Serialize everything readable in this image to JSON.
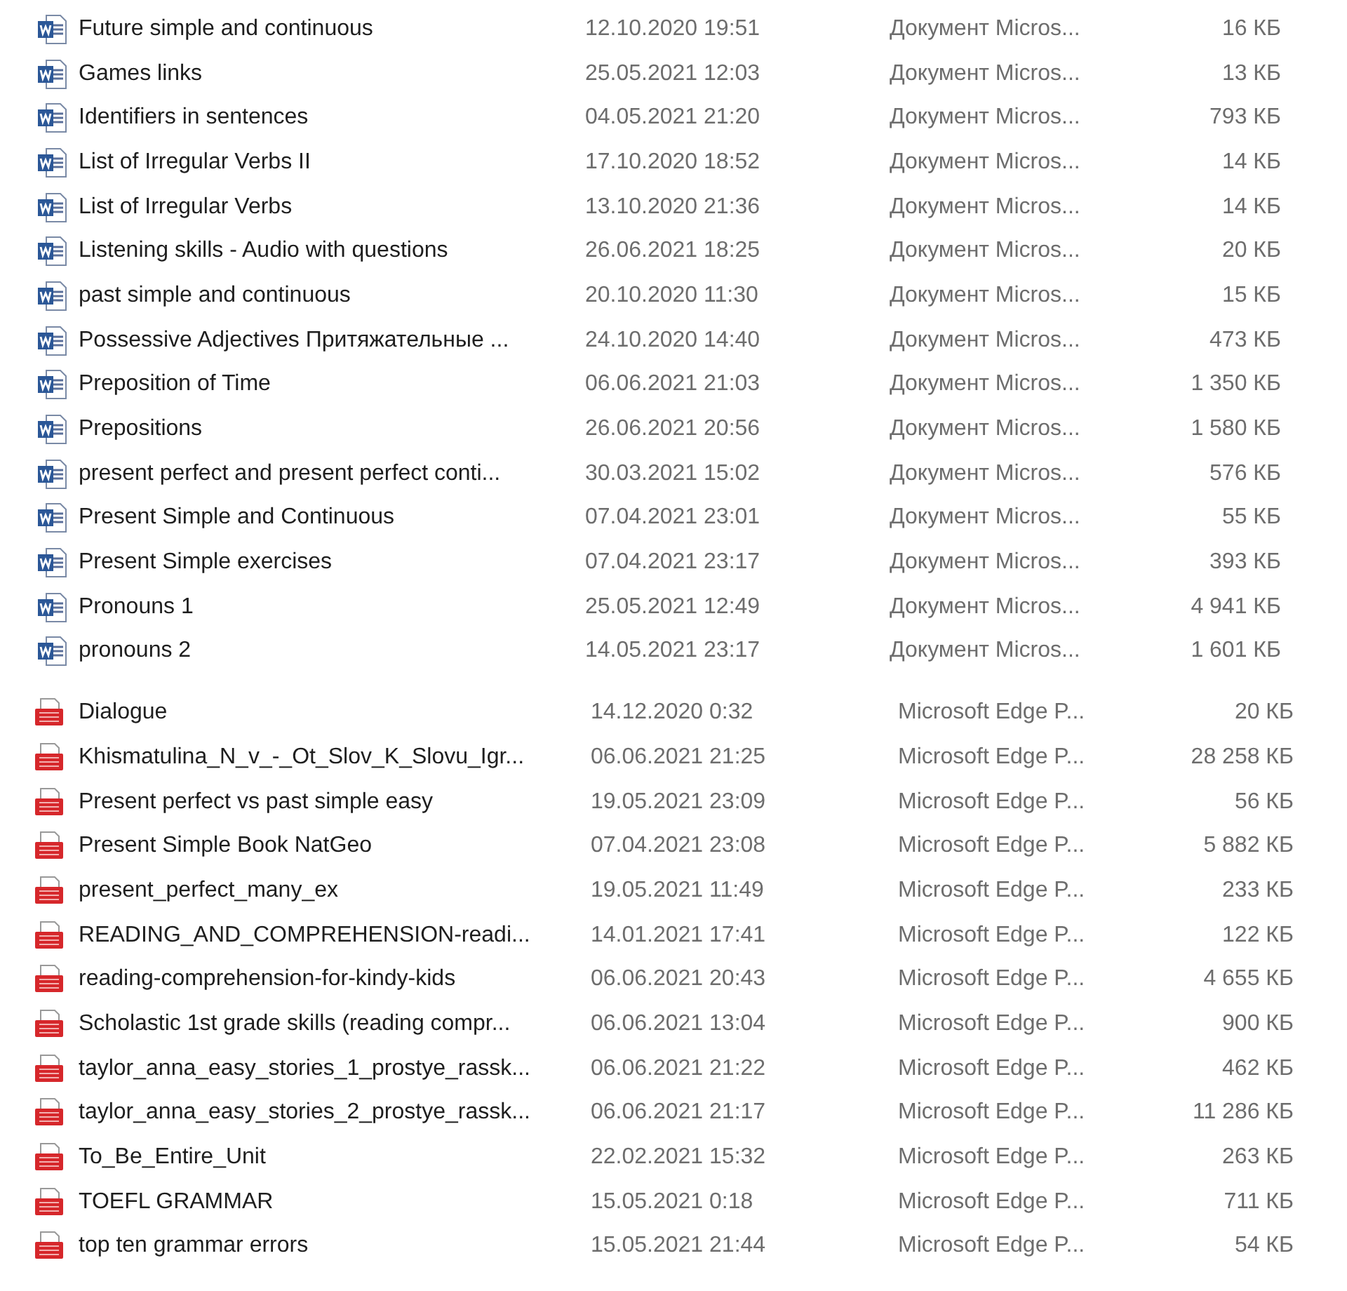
{
  "sections": [
    {
      "kind": "word",
      "files": [
        {
          "name": "Future simple and continuous",
          "date": "12.10.2020 19:51",
          "type": "Документ Micros...",
          "size": "16 КБ"
        },
        {
          "name": "Games links",
          "date": "25.05.2021 12:03",
          "type": "Документ Micros...",
          "size": "13 КБ"
        },
        {
          "name": "Identifiers in sentences",
          "date": "04.05.2021 21:20",
          "type": "Документ Micros...",
          "size": "793 КБ"
        },
        {
          "name": "List of Irregular Verbs II",
          "date": "17.10.2020 18:52",
          "type": "Документ Micros...",
          "size": "14 КБ"
        },
        {
          "name": "List of Irregular Verbs",
          "date": "13.10.2020 21:36",
          "type": "Документ Micros...",
          "size": "14 КБ"
        },
        {
          "name": "Listening skills - Audio with questions",
          "date": "26.06.2021 18:25",
          "type": "Документ Micros...",
          "size": "20 КБ"
        },
        {
          "name": "past simple and continuous",
          "date": "20.10.2020 11:30",
          "type": "Документ Micros...",
          "size": "15 КБ"
        },
        {
          "name": "Possessive Adjectives Притяжательные ...",
          "date": "24.10.2020 14:40",
          "type": "Документ Micros...",
          "size": "473 КБ"
        },
        {
          "name": "Preposition of Time",
          "date": "06.06.2021 21:03",
          "type": "Документ Micros...",
          "size": "1 350 КБ"
        },
        {
          "name": "Prepositions",
          "date": "26.06.2021 20:56",
          "type": "Документ Micros...",
          "size": "1 580 КБ"
        },
        {
          "name": "present perfect and present perfect conti...",
          "date": "30.03.2021 15:02",
          "type": "Документ Micros...",
          "size": "576 КБ"
        },
        {
          "name": "Present Simple and Continuous",
          "date": "07.04.2021 23:01",
          "type": "Документ Micros...",
          "size": "55 КБ"
        },
        {
          "name": "Present Simple exercises",
          "date": "07.04.2021 23:17",
          "type": "Документ Micros...",
          "size": "393 КБ"
        },
        {
          "name": "Pronouns 1",
          "date": "25.05.2021 12:49",
          "type": "Документ Micros...",
          "size": "4 941 КБ"
        },
        {
          "name": "pronouns 2",
          "date": "14.05.2021 23:17",
          "type": "Документ Micros...",
          "size": "1 601 КБ"
        }
      ]
    },
    {
      "kind": "pdf",
      "files": [
        {
          "name": "Dialogue",
          "date": "14.12.2020 0:32",
          "type": "Microsoft Edge P...",
          "size": "20 КБ"
        },
        {
          "name": "Khismatulina_N_v_-_Ot_Slov_K_Slovu_Igr...",
          "date": "06.06.2021 21:25",
          "type": "Microsoft Edge P...",
          "size": "28 258 КБ"
        },
        {
          "name": "Present perfect vs past simple easy",
          "date": "19.05.2021 23:09",
          "type": "Microsoft Edge P...",
          "size": "56 КБ"
        },
        {
          "name": "Present Simple Book NatGeo",
          "date": "07.04.2021 23:08",
          "type": "Microsoft Edge P...",
          "size": "5 882 КБ"
        },
        {
          "name": "present_perfect_many_ex",
          "date": "19.05.2021 11:49",
          "type": "Microsoft Edge P...",
          "size": "233 КБ"
        },
        {
          "name": "READING_AND_COMPREHENSION-readi...",
          "date": "14.01.2021 17:41",
          "type": "Microsoft Edge P...",
          "size": "122 КБ"
        },
        {
          "name": "reading-comprehension-for-kindy-kids",
          "date": "06.06.2021 20:43",
          "type": "Microsoft Edge P...",
          "size": "4 655 КБ"
        },
        {
          "name": "Scholastic 1st grade skills (reading compr...",
          "date": "06.06.2021 13:04",
          "type": "Microsoft Edge P...",
          "size": "900 КБ"
        },
        {
          "name": "taylor_anna_easy_stories_1_prostye_rassk...",
          "date": "06.06.2021 21:22",
          "type": "Microsoft Edge P...",
          "size": "462 КБ"
        },
        {
          "name": "taylor_anna_easy_stories_2_prostye_rassk...",
          "date": "06.06.2021 21:17",
          "type": "Microsoft Edge P...",
          "size": "11 286 КБ"
        },
        {
          "name": "To_Be_Entire_Unit",
          "date": "22.02.2021 15:32",
          "type": "Microsoft Edge P...",
          "size": "263 КБ"
        },
        {
          "name": "TOEFL GRAMMAR",
          "date": "15.05.2021 0:18",
          "type": "Microsoft Edge P...",
          "size": "711 КБ"
        },
        {
          "name": "top ten grammar errors",
          "date": "15.05.2021 21:44",
          "type": "Microsoft Edge P...",
          "size": "54 КБ"
        }
      ]
    }
  ]
}
